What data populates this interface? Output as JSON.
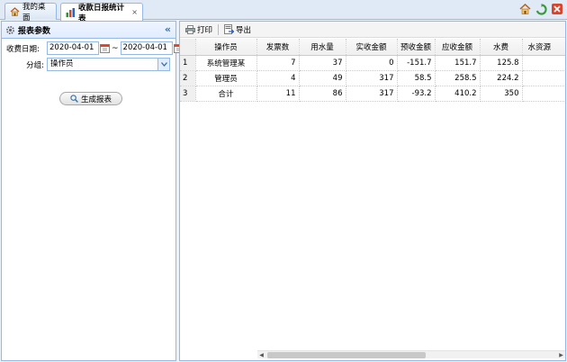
{
  "tabs": [
    {
      "label": "我的桌面",
      "icon": "home-icon",
      "active": false
    },
    {
      "label": "收款日报统计表",
      "icon": "bar-chart-icon",
      "active": true,
      "close": "×"
    }
  ],
  "top_right_icons": [
    "home-icon",
    "refresh-icon",
    "close-icon"
  ],
  "sidebar": {
    "title": "报表参数",
    "collapse": "«",
    "date_label": "收费日期:",
    "date_from": "2020-04-01",
    "date_sep": "~",
    "date_to": "2020-04-01",
    "group_label": "分组:",
    "group_value": "操作员",
    "generate_label": "生成报表"
  },
  "toolbar": {
    "print_label": "打印",
    "export_label": "导出"
  },
  "table": {
    "columns": [
      "操作员",
      "发票数",
      "用水量",
      "实收金额",
      "预收金额",
      "应收金额",
      "水费",
      "水资源"
    ],
    "rows": [
      {
        "n": "1",
        "cells": [
          "系统管理某",
          "7",
          "37",
          "0",
          "-151.7",
          "151.7",
          "125.8",
          ""
        ]
      },
      {
        "n": "2",
        "cells": [
          "管理员",
          "4",
          "49",
          "317",
          "58.5",
          "258.5",
          "224.2",
          ""
        ]
      },
      {
        "n": "3",
        "cells": [
          "合计",
          "11",
          "86",
          "317",
          "-93.2",
          "410.2",
          "350",
          ""
        ]
      }
    ]
  },
  "colors": {
    "border": "#95b8e7",
    "accent": "#3a6ea5"
  }
}
